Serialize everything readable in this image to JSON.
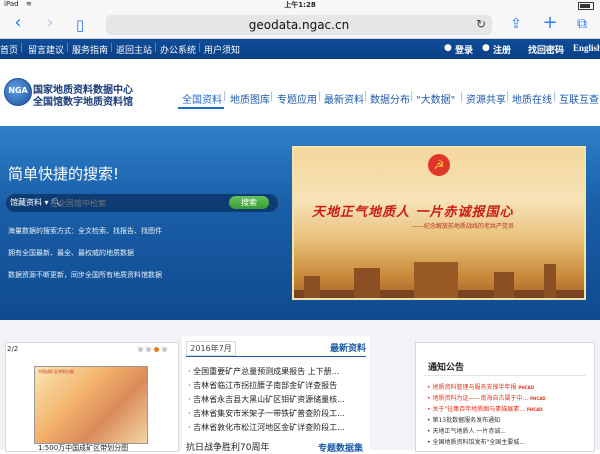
{
  "status_bar": {
    "carrier": "iPad",
    "time": "上午1:28"
  },
  "browser": {
    "url": "geodata.ngac.cn",
    "back_icon": "chevron-left-icon",
    "forward_icon": "chevron-right-icon",
    "bookmarks_icon": "book-icon",
    "reload_icon": "reload-icon",
    "share_icon": "share-icon",
    "new_tab_icon": "plus-icon",
    "tabs_icon": "tabs-icon"
  },
  "top_nav": {
    "links": [
      "首页",
      "留言建议",
      "服务指南",
      "返回主站",
      "办公系统",
      "用户须知"
    ],
    "login": "登录",
    "register": "注册",
    "forgot": "找回密码",
    "english": "English"
  },
  "header": {
    "logo_text": "NGA",
    "org_line1": "国家地质资料数据中心",
    "org_line2": "全国馆数字地质资料馆",
    "nav": [
      "全国资料",
      "地质图库",
      "专题应用",
      "最新资料",
      "数据分布",
      "\"大数据\"",
      "资源共享",
      "地质在线",
      "互联互查"
    ]
  },
  "hero": {
    "title": "简单快捷的搜索!",
    "search_category": "馆藏资料",
    "search_placeholder": "在全国馆中检索",
    "search_button": "搜索",
    "lines": [
      "海量数据的搜索方式：全文检索、找报告、找图件",
      "拥有全国最新、最全、最权威的地质数据",
      "数据资源不断更新，同步全国所有地质资料馆数据"
    ]
  },
  "banner": {
    "slogan": "天地正气地质人  一片赤诚报国心",
    "subtitle": "——纪念解放前地质战线的老共产党员"
  },
  "carousel": {
    "pager": "2/2",
    "map_title": "中国成矿区带划分图",
    "caption": "1:500万中国成矿区带划分图"
  },
  "news": {
    "date_tab": "2016年7月",
    "heading": "最新资料",
    "items": [
      "全国重要矿产总量预测成果报告 上下册...",
      "吉林省临江市拐拉腰子南部金矿详查报告",
      "吉林省永吉县大黑山矿区钼矿资源储量核...",
      "吉林省集安市米架子一带铁矿普查阶段工...",
      "吉林省敦化市松江河地区金矿详查阶段工..."
    ],
    "bottom_tab": "抗日战争胜利70周年",
    "bottom_heading": "专题数据集"
  },
  "notices": {
    "title": "通知公告",
    "badge": "PHCAD",
    "items": [
      {
        "text": "地质资料管理与服务支撑半年报",
        "color": "#e6331d",
        "badge": true
      },
      {
        "text": "地质资料为证——南海自古属于中...",
        "color": "#e6331d",
        "badge": true
      },
      {
        "text": "关于\"征集百年地质图与素描展素...",
        "color": "#e6331d",
        "badge": true
      },
      {
        "text": "第13批数据服务发布通知",
        "color": "#333333",
        "badge": false
      },
      {
        "text": "天地正气地质人 一片赤诚...",
        "color": "#333333",
        "badge": false
      },
      {
        "text": "全国地质资料馆发布\"全国主要城...",
        "color": "#333333",
        "badge": false
      }
    ]
  }
}
